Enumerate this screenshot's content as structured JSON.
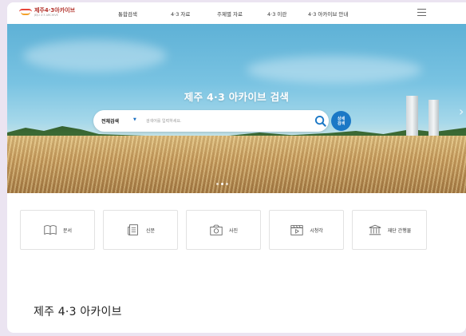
{
  "header": {
    "logo_text": "제주4·3아카이브",
    "logo_subtitle": "JEJU 4·3 ARCHIVE",
    "nav": [
      "통합검색",
      "4·3 자료",
      "주제별 자료",
      "4·3 이란",
      "4·3 아카이브 안내"
    ]
  },
  "hero": {
    "title": "제주 4·3 아카이브 검색",
    "search_scope": "전체검색",
    "search_placeholder": "검색어를 입력하세요.",
    "detail_button_line1": "상세",
    "detail_button_line2": "검색"
  },
  "categories": [
    {
      "label": "문서",
      "icon": "book-icon"
    },
    {
      "label": "신문",
      "icon": "newspaper-icon"
    },
    {
      "label": "사진",
      "icon": "camera-icon"
    },
    {
      "label": "시청각",
      "icon": "clapperboard-icon"
    },
    {
      "label": "재단 간행물",
      "icon": "building-icon"
    }
  ],
  "section_title": "제주 4·3 아카이브",
  "colors": {
    "accent": "#1b78c6",
    "page_bg": "#ebe4f1"
  }
}
